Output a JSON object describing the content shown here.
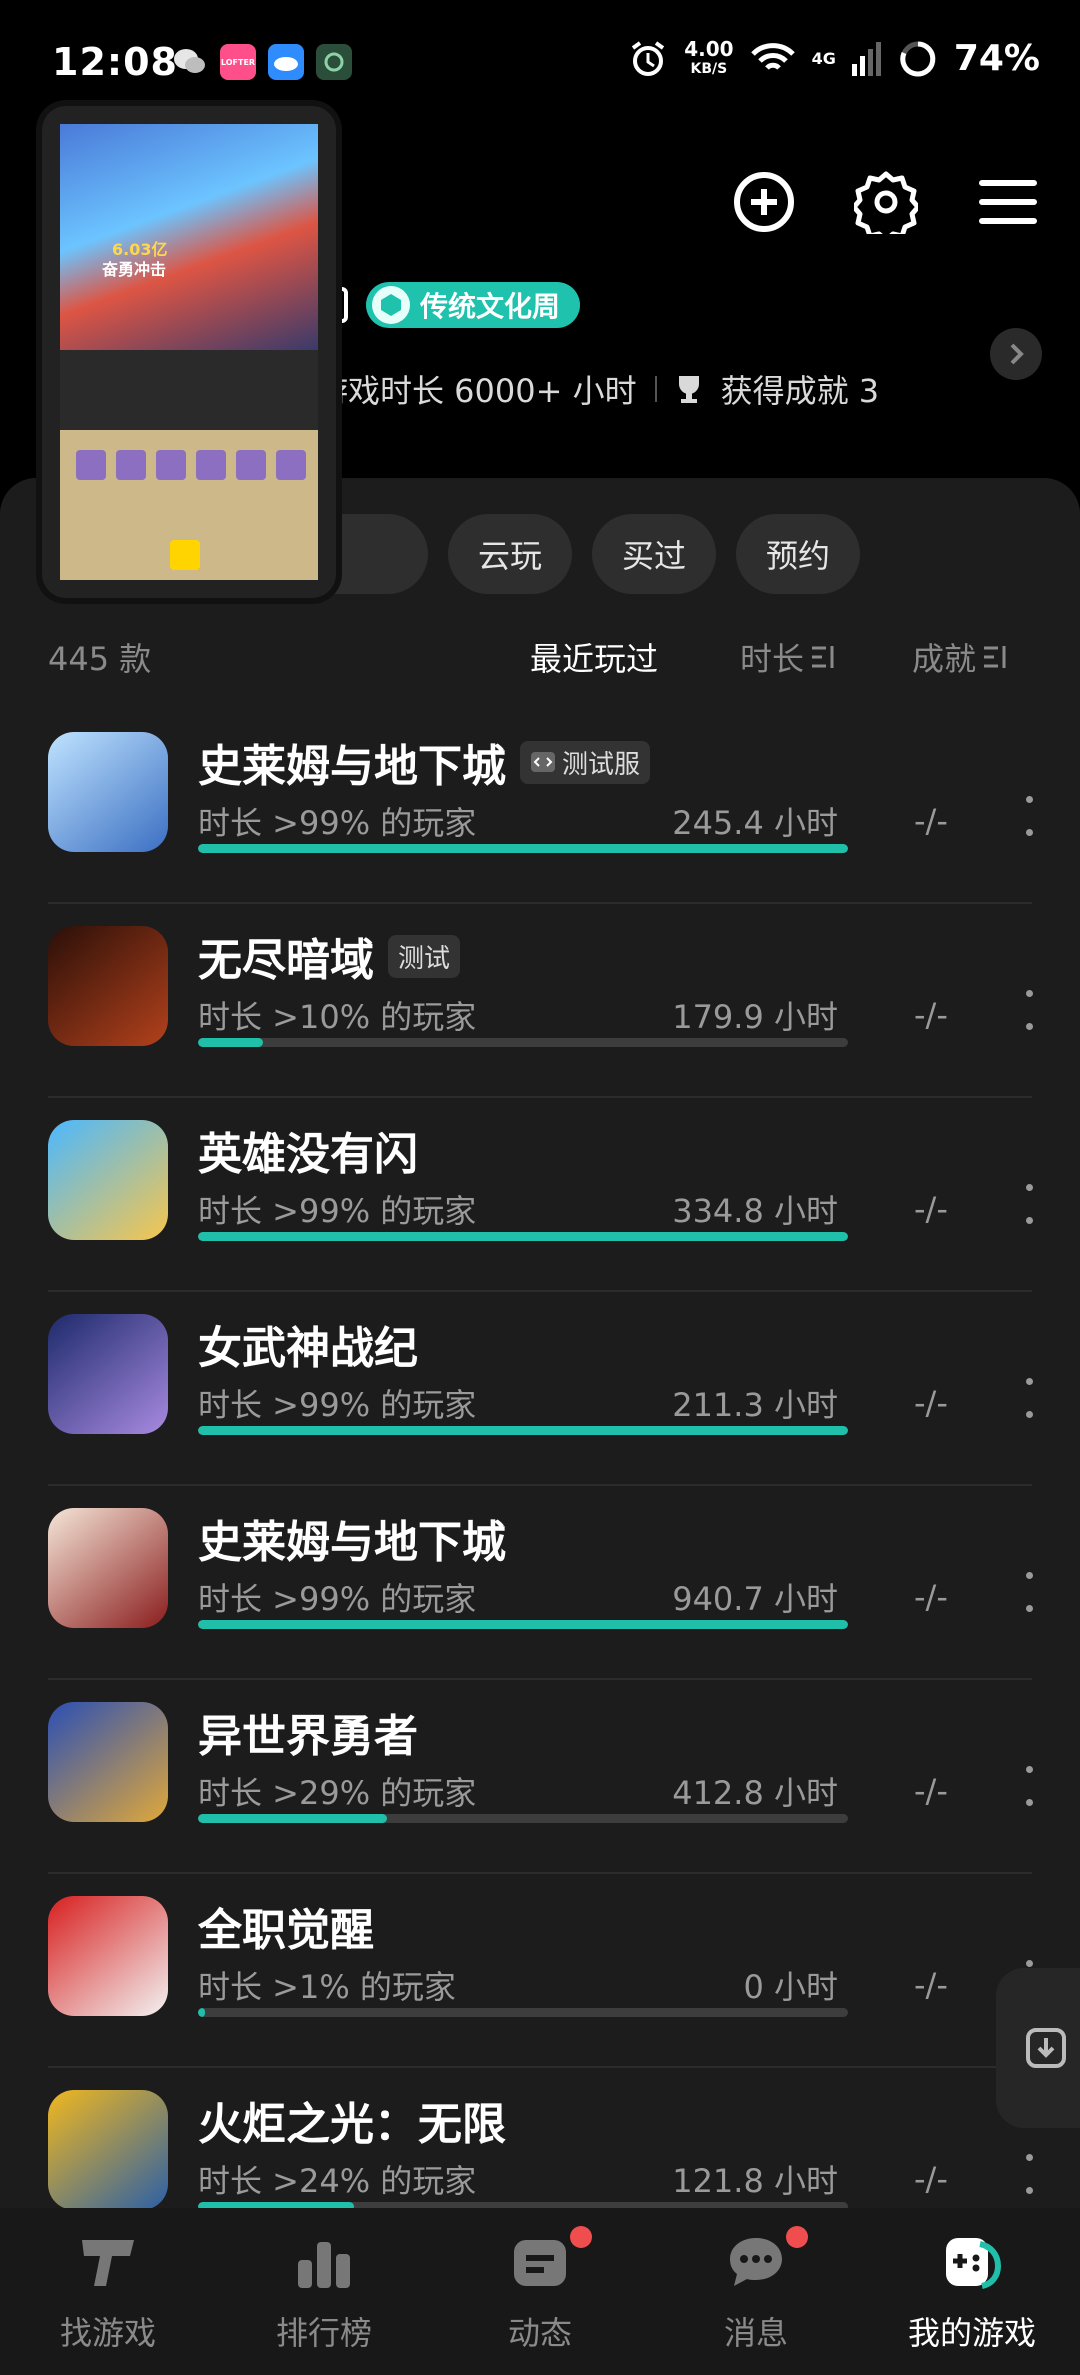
{
  "status_bar": {
    "time": "12:08",
    "speed_value": "4.00",
    "speed_unit": "KB/S",
    "network": "4G",
    "battery": "74%",
    "app_icons": [
      {
        "name": "wechat-icon",
        "color": "#e6e6e6"
      },
      {
        "name": "lofter-app-icon",
        "color": "#ff4f8a",
        "text": "LOFTER"
      },
      {
        "name": "weather-app-icon",
        "color": "#2f8cff"
      },
      {
        "name": "game-app-icon",
        "color": "#2b4e3a"
      }
    ]
  },
  "header": {
    "badge_label": "传统文化周",
    "playtime": "游戏时长 6000+ 小时",
    "achievements": "获得成就 3"
  },
  "filters": {
    "chips": [
      "云玩",
      "买过",
      "预约"
    ]
  },
  "list_header": {
    "count": "445 款",
    "sort_recent": "最近玩过",
    "sort_duration": "时长",
    "sort_achievement": "成就"
  },
  "games": [
    {
      "name": "史莱姆与地下城",
      "tag": "测试服",
      "tag_icon": true,
      "pct": "时长 >99% 的玩家",
      "hours": "245.4 小时",
      "progress": 1.0,
      "ach": "-/-",
      "color_a": "#bfe3ff",
      "color_b": "#3b6fc2"
    },
    {
      "name": "无尽暗域",
      "tag": "测试",
      "tag_icon": false,
      "pct": "时长 >10% 的玩家",
      "hours": "179.9 小时",
      "progress": 0.1,
      "ach": "-/-",
      "color_a": "#2a0f08",
      "color_b": "#b3411c"
    },
    {
      "name": "英雄没有闪",
      "tag": "",
      "tag_icon": false,
      "pct": "时长 >99% 的玩家",
      "hours": "334.8 小时",
      "progress": 1.0,
      "ach": "-/-",
      "color_a": "#4bb8ff",
      "color_b": "#f7c64d"
    },
    {
      "name": "女武神战纪",
      "tag": "",
      "tag_icon": false,
      "pct": "时长 >99% 的玩家",
      "hours": "211.3 小时",
      "progress": 1.0,
      "ach": "-/-",
      "color_a": "#1d2a6b",
      "color_b": "#a88ae0"
    },
    {
      "name": "史莱姆与地下城",
      "tag": "",
      "tag_icon": false,
      "pct": "时长 >99% 的玩家",
      "hours": "940.7 小时",
      "progress": 1.0,
      "ach": "-/-",
      "color_a": "#f5e6d8",
      "color_b": "#8a1d1d"
    },
    {
      "name": "异世界勇者",
      "tag": "",
      "tag_icon": false,
      "pct": "时长 >29% 的玩家",
      "hours": "412.8 小时",
      "progress": 0.29,
      "ach": "-/-",
      "color_a": "#2a4fb5",
      "color_b": "#e0a83a"
    },
    {
      "name": "全职觉醒",
      "tag": "",
      "tag_icon": false,
      "pct": "时长 >1% 的玩家",
      "hours": "0 小时",
      "progress": 0.01,
      "ach": "-/-",
      "color_a": "#d81f1f",
      "color_b": "#f2f2f2"
    },
    {
      "name": "火炬之光：无限",
      "tag": "",
      "tag_icon": false,
      "pct": "时长 >24% 的玩家",
      "hours": "121.8 小时",
      "progress": 0.24,
      "ach": "-/-",
      "color_a": "#f1b81e",
      "color_b": "#2b5fa6"
    }
  ],
  "pip": {
    "text_1": "奋勇冲击",
    "text_2": "6.03亿"
  },
  "nav": {
    "items": [
      {
        "label": "找游戏",
        "dot": false
      },
      {
        "label": "排行榜",
        "dot": false
      },
      {
        "label": "动态",
        "dot": true
      },
      {
        "label": "消息",
        "dot": true
      },
      {
        "label": "我的游戏",
        "dot": false
      }
    ]
  },
  "colors": {
    "accent": "#1fbfa9",
    "notification": "#f04e4e"
  }
}
